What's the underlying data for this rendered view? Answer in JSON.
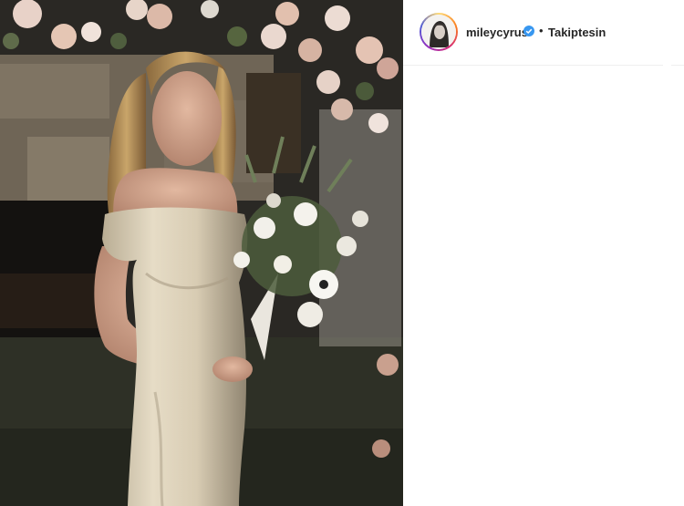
{
  "post": {
    "image_alt": "miley cyrus wedding photo with bouquet"
  },
  "header": {
    "username": "mileycyrus",
    "separator": "•",
    "follow_status": "Takiptesin",
    "verified": true,
    "avatar_icon": "profile-avatar"
  },
  "colors": {
    "text": "#262626",
    "verified_badge": "#3897f0",
    "divider": "#efefef"
  }
}
